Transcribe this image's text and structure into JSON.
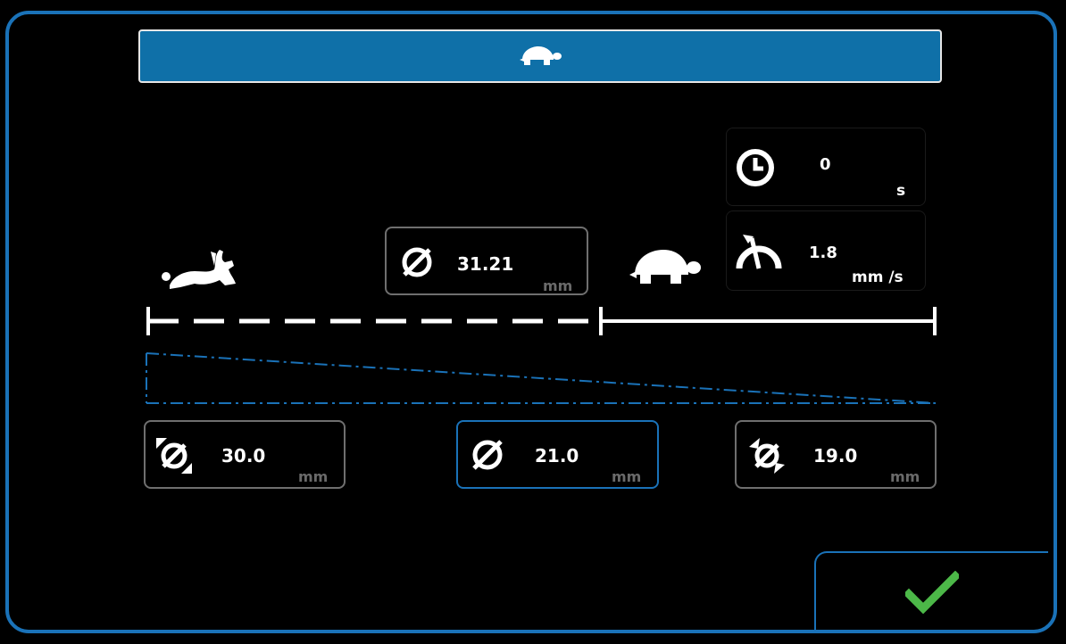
{
  "header": {
    "icon": "turtle-icon"
  },
  "timer": {
    "icon": "clock-icon",
    "value": "0",
    "unit": "s"
  },
  "speed": {
    "icon": "speed-gauge-icon",
    "value": "1.8",
    "unit": "mm /s"
  },
  "current_diameter": {
    "icon": "diameter-icon",
    "value": "31.21",
    "unit": "mm"
  },
  "scale_left_icon": "rabbit-icon",
  "scale_right_icon": "turtle-icon",
  "settings": [
    {
      "icon": "diameter-start-icon",
      "value": "30.0",
      "unit": "mm"
    },
    {
      "icon": "diameter-icon",
      "value": "21.0",
      "unit": "mm"
    },
    {
      "icon": "diameter-end-icon",
      "value": "19.0",
      "unit": "mm"
    }
  ],
  "confirm": {
    "icon": "checkmark-icon"
  },
  "colors": {
    "accent": "#1a72b8",
    "header": "#0f70a8",
    "confirm": "#4cb848",
    "unit": "#6a6a6a"
  }
}
